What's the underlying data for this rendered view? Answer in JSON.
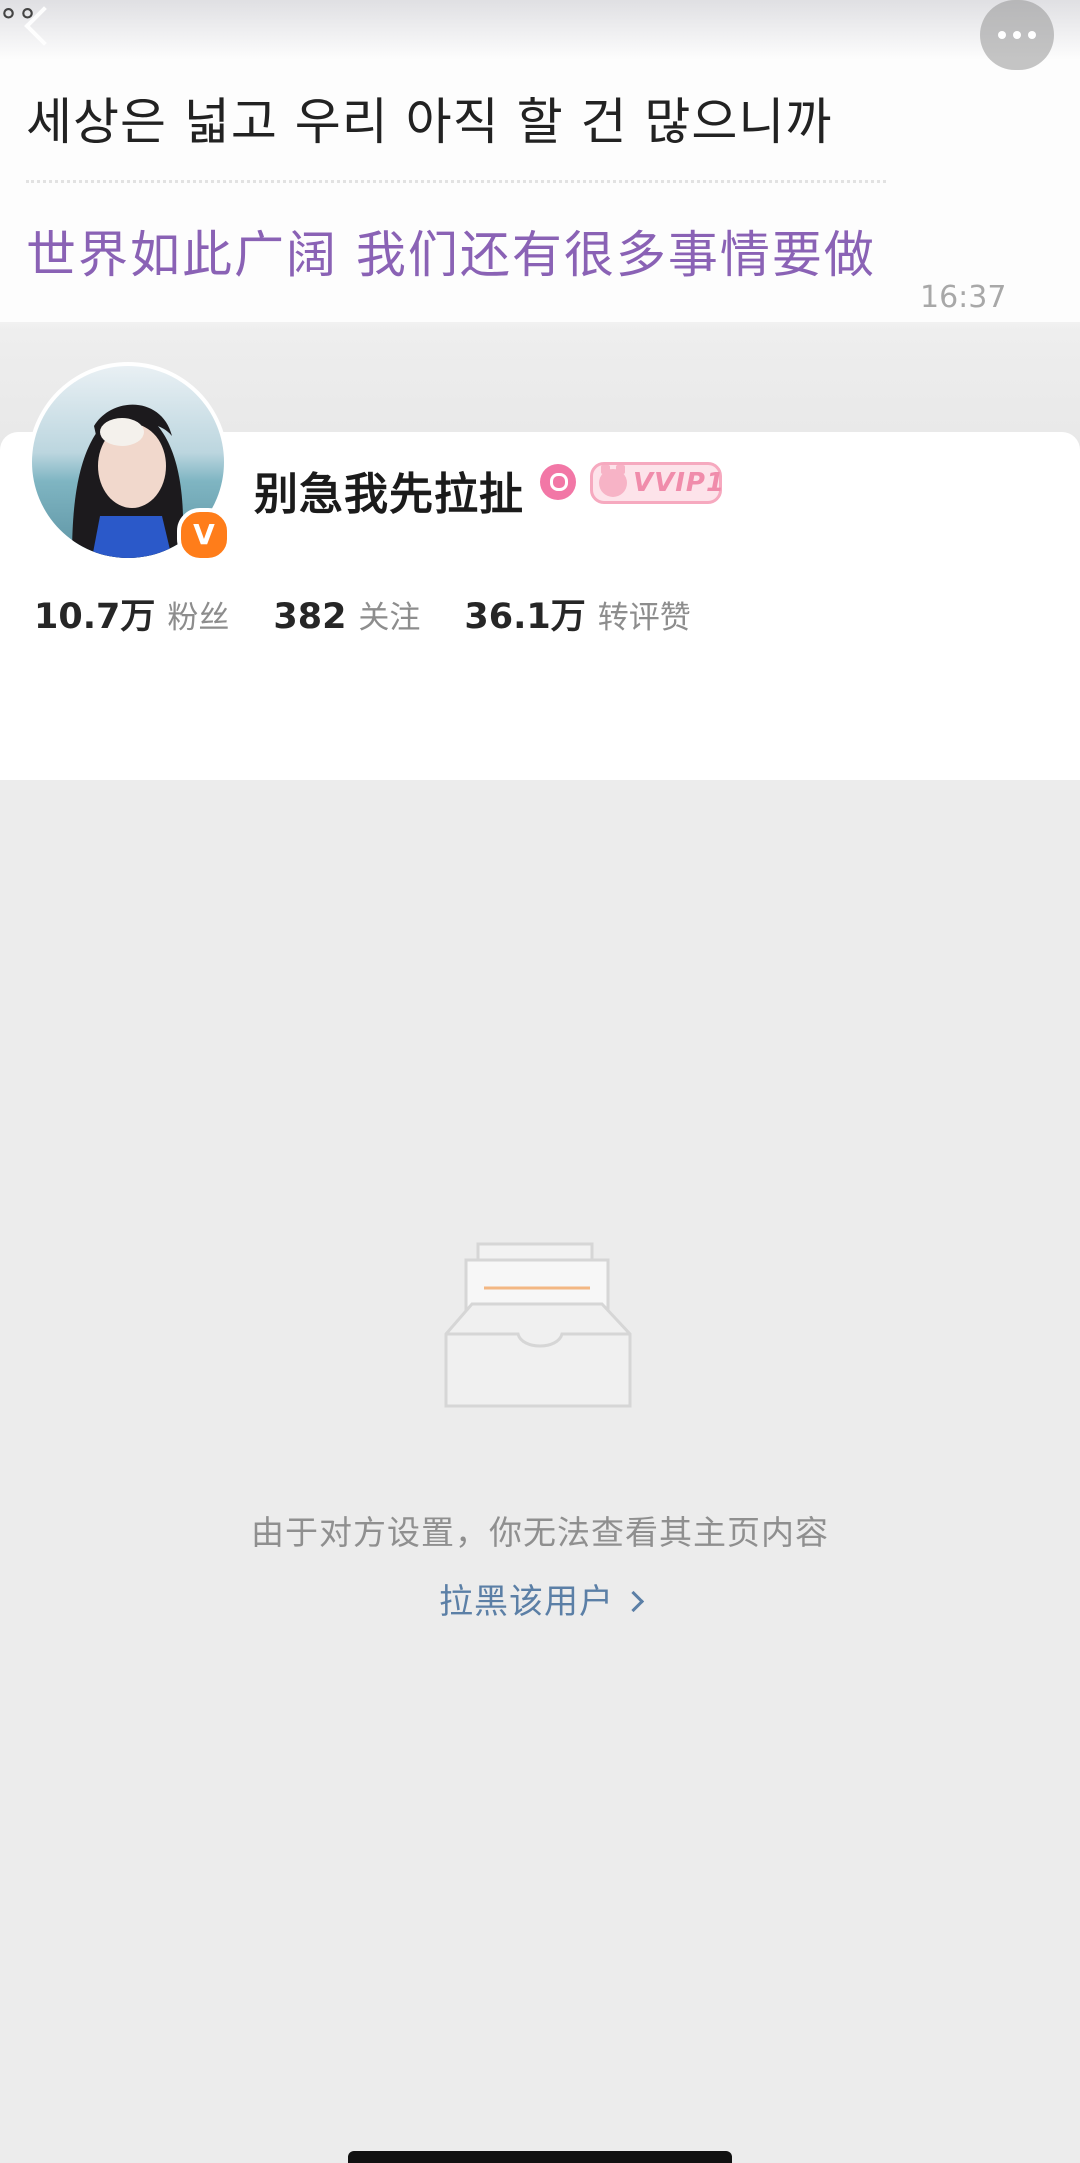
{
  "header": {
    "ghost_glyphs": "°°",
    "korean_text": "세상은 넓고 우리 아직 할 건 많으니까",
    "chinese_text": "世界如此广阔 我们还有很多事情要做",
    "message_time": "16:37",
    "back_icon": "chevron-left-icon",
    "more_icon": "more-horizontal-icon"
  },
  "profile": {
    "username": "别急我先拉扯",
    "verified_badge": "V",
    "vip_label": "VVIP1",
    "gender_color": "#f277a6",
    "stats": [
      {
        "value": "10.7万",
        "label": "粉丝"
      },
      {
        "value": "382",
        "label": "关注"
      },
      {
        "value": "36.1万",
        "label": "转评赞"
      }
    ]
  },
  "empty_state": {
    "message": "由于对方设置，你无法查看其主页内容",
    "block_link": "拉黑该用户"
  },
  "colors": {
    "accent_link": "#5b7fa6",
    "verified": "#ff7d1a",
    "chinese_text": "#8a62b5"
  }
}
